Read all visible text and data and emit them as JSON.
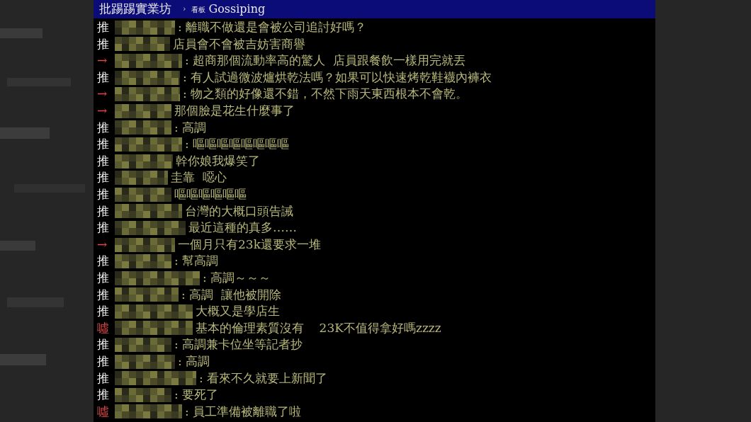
{
  "header": {
    "site": "批踢踢實業坊",
    "separator": "›",
    "board_label": "看板",
    "board": "Gossiping"
  },
  "comments": [
    {
      "kind": "push",
      "tag": "推",
      "text": ": 離職不做還是會被公司追討好嗎？"
    },
    {
      "kind": "push",
      "tag": "推",
      "text": "店員會不會被吉妨害商譽"
    },
    {
      "kind": "arrow",
      "tag": "→",
      "text": ": 超商那個流動率高的驚人  店員跟餐飲一樣用完就丟"
    },
    {
      "kind": "push",
      "tag": "推",
      "text": ": 有人試過微波爐烘乾法嗎？如果可以快速烤乾鞋襪內褲衣"
    },
    {
      "kind": "arrow",
      "tag": "→",
      "text": ": 物之類的好像還不錯，不然下雨天東西根本不會乾。"
    },
    {
      "kind": "arrow",
      "tag": "→",
      "text": "那個臉是花生什麼事了"
    },
    {
      "kind": "push",
      "tag": "推",
      "text": ": 高調"
    },
    {
      "kind": "push",
      "tag": "推",
      "text": ": 嘔嘔嘔嘔嘔嘔嘔嘔"
    },
    {
      "kind": "push",
      "tag": "推",
      "text": "幹你娘我爆笑了"
    },
    {
      "kind": "push",
      "tag": "推",
      "text": "圭靠  噁心"
    },
    {
      "kind": "push",
      "tag": "推",
      "text": "嘔嘔嘔嘔嘔嘔"
    },
    {
      "kind": "push",
      "tag": "推",
      "text": "台灣的大概口頭告誡"
    },
    {
      "kind": "push",
      "tag": "推",
      "text": "最近這種的真多……"
    },
    {
      "kind": "arrow",
      "tag": "→",
      "text": "一個月只有23k還要求一堆"
    },
    {
      "kind": "push",
      "tag": "推",
      "text": ": 幫高調"
    },
    {
      "kind": "push",
      "tag": "推",
      "text": ": 高調～～～"
    },
    {
      "kind": "push",
      "tag": "推",
      "text": ": 高調  讓他被開除"
    },
    {
      "kind": "push",
      "tag": "推",
      "text": "大概又是學店生"
    },
    {
      "kind": "boo",
      "tag": "噓",
      "text": "基本的倫理素質沒有    23K不值得拿好嗎zzzz"
    },
    {
      "kind": "push",
      "tag": "推",
      "text": ": 高調兼卡位坐等記者抄"
    },
    {
      "kind": "push",
      "tag": "推",
      "text": ": 高調"
    },
    {
      "kind": "push",
      "tag": "推",
      "text": ": 看來不久就要上新聞了"
    },
    {
      "kind": "push",
      "tag": "推",
      "text": ": 要死了"
    },
    {
      "kind": "boo",
      "tag": "噓",
      "text": ": 員工準備被離職了啦"
    }
  ]
}
